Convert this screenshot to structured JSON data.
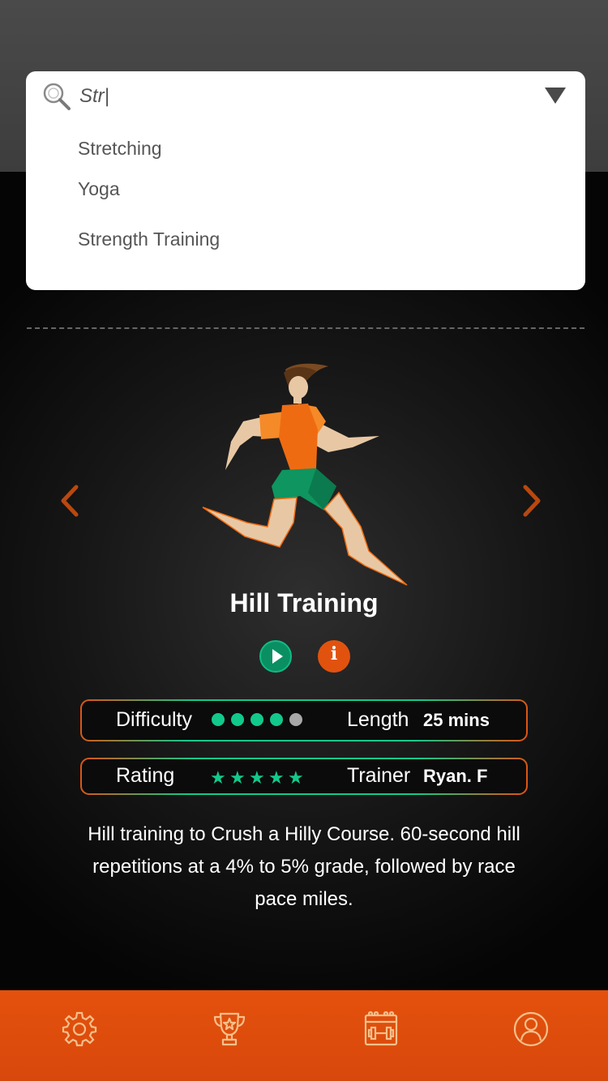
{
  "search": {
    "value": "Str|",
    "suggestions": [
      "Stretching",
      "Yoga",
      "Strength Training"
    ]
  },
  "workout": {
    "title": "Hill Training",
    "difficulty_label": "Difficulty",
    "difficulty_level": 4,
    "difficulty_max": 5,
    "length_label": "Length",
    "length_value": "25 mins",
    "rating_label": "Rating",
    "rating_stars": 5,
    "trainer_label": "Trainer",
    "trainer_value": "Ryan. F",
    "description": "Hill training to Crush a Hilly Course. 60-second hill repetitions at a 4% to 5% grade, followed by race pace miles."
  },
  "nav": {
    "items": [
      "gear-icon",
      "trophy-icon",
      "calendar-dumbbell-icon",
      "profile-icon"
    ]
  },
  "colors": {
    "accent_orange": "#e2520f",
    "accent_green": "#12c98c",
    "nav_bg": "#e04f0d"
  }
}
